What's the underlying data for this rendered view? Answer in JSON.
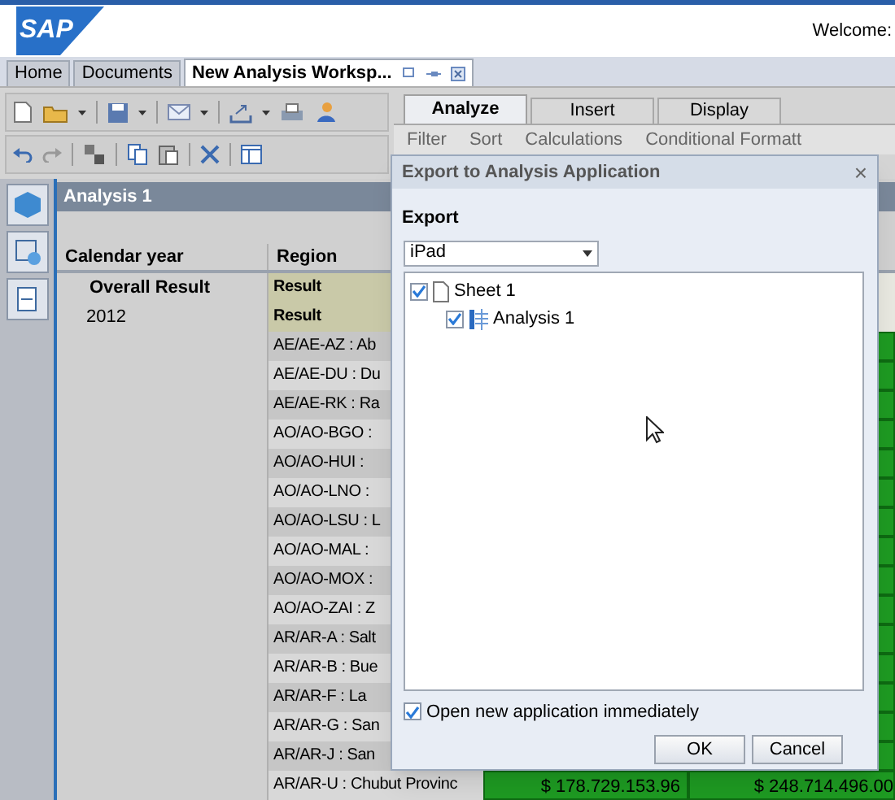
{
  "header": {
    "logo": "SAP",
    "welcome": "Welcome:"
  },
  "tabs": [
    {
      "label": "Home",
      "selected": false
    },
    {
      "label": "Documents",
      "selected": false
    },
    {
      "label": "New Analysis Worksp...",
      "selected": true
    }
  ],
  "ribbon_tabs": [
    {
      "label": "Analyze",
      "selected": true
    },
    {
      "label": "Insert",
      "selected": false
    },
    {
      "label": "Display",
      "selected": false
    }
  ],
  "ribbon_tools": [
    "Filter",
    "Sort",
    "Calculations",
    "Conditional Formatt"
  ],
  "panel": {
    "title": "Analysis 1"
  },
  "table": {
    "columns": [
      "Calendar year",
      "Region"
    ],
    "rows": [
      {
        "kind": "result",
        "year": "Overall Result",
        "region": "Result"
      },
      {
        "kind": "result",
        "year": "2012",
        "region": "Result"
      },
      {
        "kind": "member",
        "region": "AE/AE-AZ : Ab"
      },
      {
        "kind": "member",
        "region": "AE/AE-DU : Du"
      },
      {
        "kind": "member",
        "region": "AE/AE-RK : Ra"
      },
      {
        "kind": "member",
        "region": "AO/AO-BGO :"
      },
      {
        "kind": "member",
        "region": "AO/AO-HUI :"
      },
      {
        "kind": "member",
        "region": "AO/AO-LNO :"
      },
      {
        "kind": "member",
        "region": "AO/AO-LSU : L"
      },
      {
        "kind": "member",
        "region": "AO/AO-MAL :"
      },
      {
        "kind": "member",
        "region": "AO/AO-MOX :"
      },
      {
        "kind": "member",
        "region": "AO/AO-ZAI : Z"
      },
      {
        "kind": "member",
        "region": "AR/AR-A : Salt"
      },
      {
        "kind": "member",
        "region": "AR/AR-B : Bue"
      },
      {
        "kind": "member",
        "region": "AR/AR-F : La"
      },
      {
        "kind": "member",
        "region": "AR/AR-G : San"
      },
      {
        "kind": "member",
        "region": "AR/AR-J : San"
      },
      {
        "kind": "member",
        "region": "AR/AR-U : Chubut Provinc",
        "column_3": "$ 178.729.153.96",
        "column_4": "$ 248.714.496.00"
      }
    ]
  },
  "dialog": {
    "title": "Export to Analysis Application",
    "close": "×",
    "section": "Export",
    "dropdown": "iPad",
    "tree": [
      {
        "label": "Sheet 1",
        "checked": true,
        "kind": "sheet",
        "children": [
          {
            "label": "Analysis 1",
            "checked": true,
            "kind": "analysis"
          }
        ]
      }
    ],
    "option": {
      "label": "Open new application immediately",
      "checked": true
    },
    "buttons": [
      "OK",
      "Cancel"
    ]
  }
}
